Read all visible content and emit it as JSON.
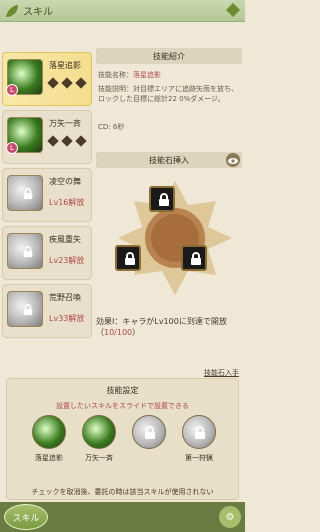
{
  "header": {
    "title": "スキル",
    "leaf_icon": "leaf-icon",
    "home_icon": "diamond-icon"
  },
  "skills": [
    {
      "name": "落星追影",
      "state": "active"
    },
    {
      "name": "万矢一斉",
      "state": "active"
    },
    {
      "name": "凌空の舞",
      "state": "locked",
      "unlock": "Lv16解放"
    },
    {
      "name": "疾風重矢",
      "state": "locked",
      "unlock": "Lv23解放"
    },
    {
      "name": "荒野召喚",
      "state": "locked",
      "unlock": "Lv33解放"
    }
  ],
  "skill_info": {
    "section_title": "技能紹介",
    "name_label": "技能名称：",
    "name_value": "落星追影",
    "desc_label": "技能説明：",
    "desc": "対目標エリアに追跡矢雨を放ち、ロックした目標に総計22 0%ダメージ。",
    "cd_label": "CD:",
    "cd_value": "6秒"
  },
  "stone": {
    "section_title": "技能石挿入",
    "eye_icon": "eye-icon",
    "effect_label": "効果Ⅰ：",
    "effect_text": "キャラがLv100に到達で開放（",
    "effect_progress": "10/100",
    "effect_end": "）",
    "link_text": "技能石入手"
  },
  "setting": {
    "section_title": "技能設定",
    "subtitle": "設置したいスキルをスライドで設置できる",
    "slots": [
      {
        "name": "落星追影"
      },
      {
        "name": "万矢一斉"
      },
      {
        "name": ""
      },
      {
        "name": "第一狩猟"
      }
    ],
    "note": "チェックを取消後、委託の時は該当スキルが使用されない"
  },
  "footer": {
    "skill_label": "スキル",
    "right_icon": "settings-icon"
  }
}
